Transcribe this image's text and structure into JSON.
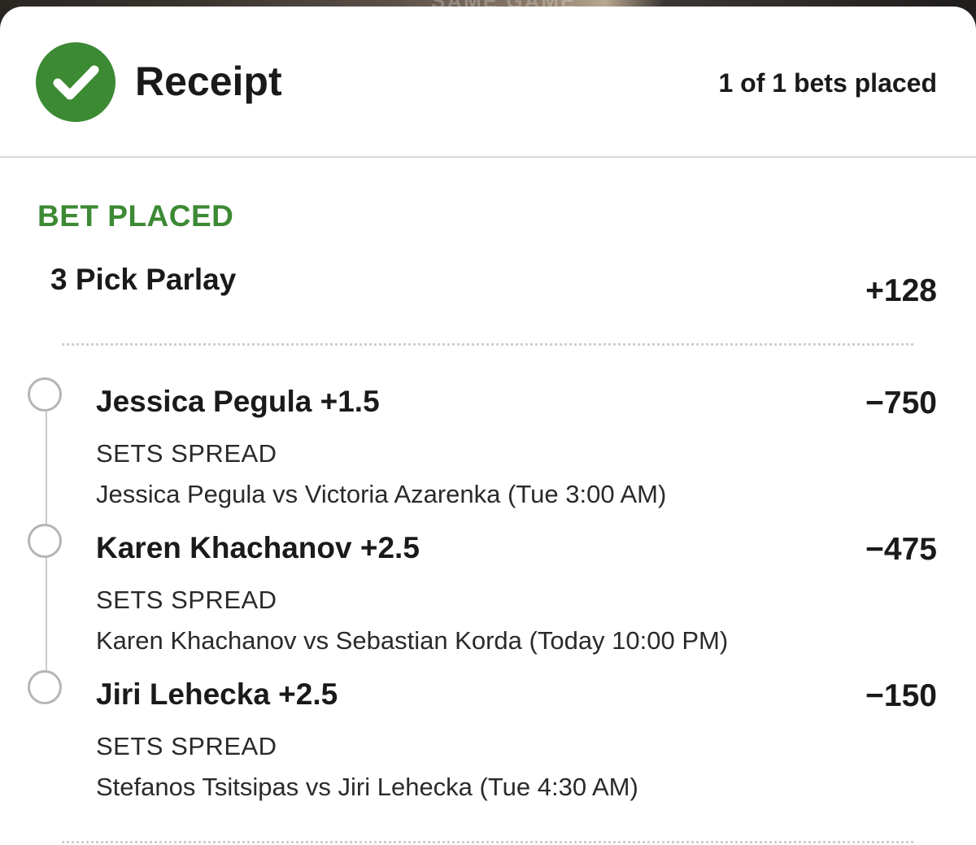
{
  "backdrop": {
    "partial_text": "SAME GAME"
  },
  "header": {
    "title": "Receipt",
    "bets_placed": "1 of 1 bets placed",
    "status_icon": "check-icon"
  },
  "bet": {
    "status": "BET PLACED",
    "type": "3 Pick Parlay",
    "odds": "+128"
  },
  "legs": [
    {
      "selection": "Jessica Pegula +1.5",
      "odds": "−750",
      "market": "SETS SPREAD",
      "event": "Jessica Pegula vs Victoria Azarenka (Tue 3:00 AM)"
    },
    {
      "selection": "Karen Khachanov +2.5",
      "odds": "−475",
      "market": "SETS SPREAD",
      "event": "Karen Khachanov vs Sebastian Korda (Today 10:00 PM)"
    },
    {
      "selection": "Jiri Lehecka +2.5",
      "odds": "−150",
      "market": "SETS SPREAD",
      "event": "Stefanos Tsitsipas vs Jiri Lehecka (Tue 4:30 AM)"
    }
  ],
  "colors": {
    "success_green": "#3c8a34",
    "text": "#1a1a1a",
    "divider": "#d9d9d9"
  }
}
